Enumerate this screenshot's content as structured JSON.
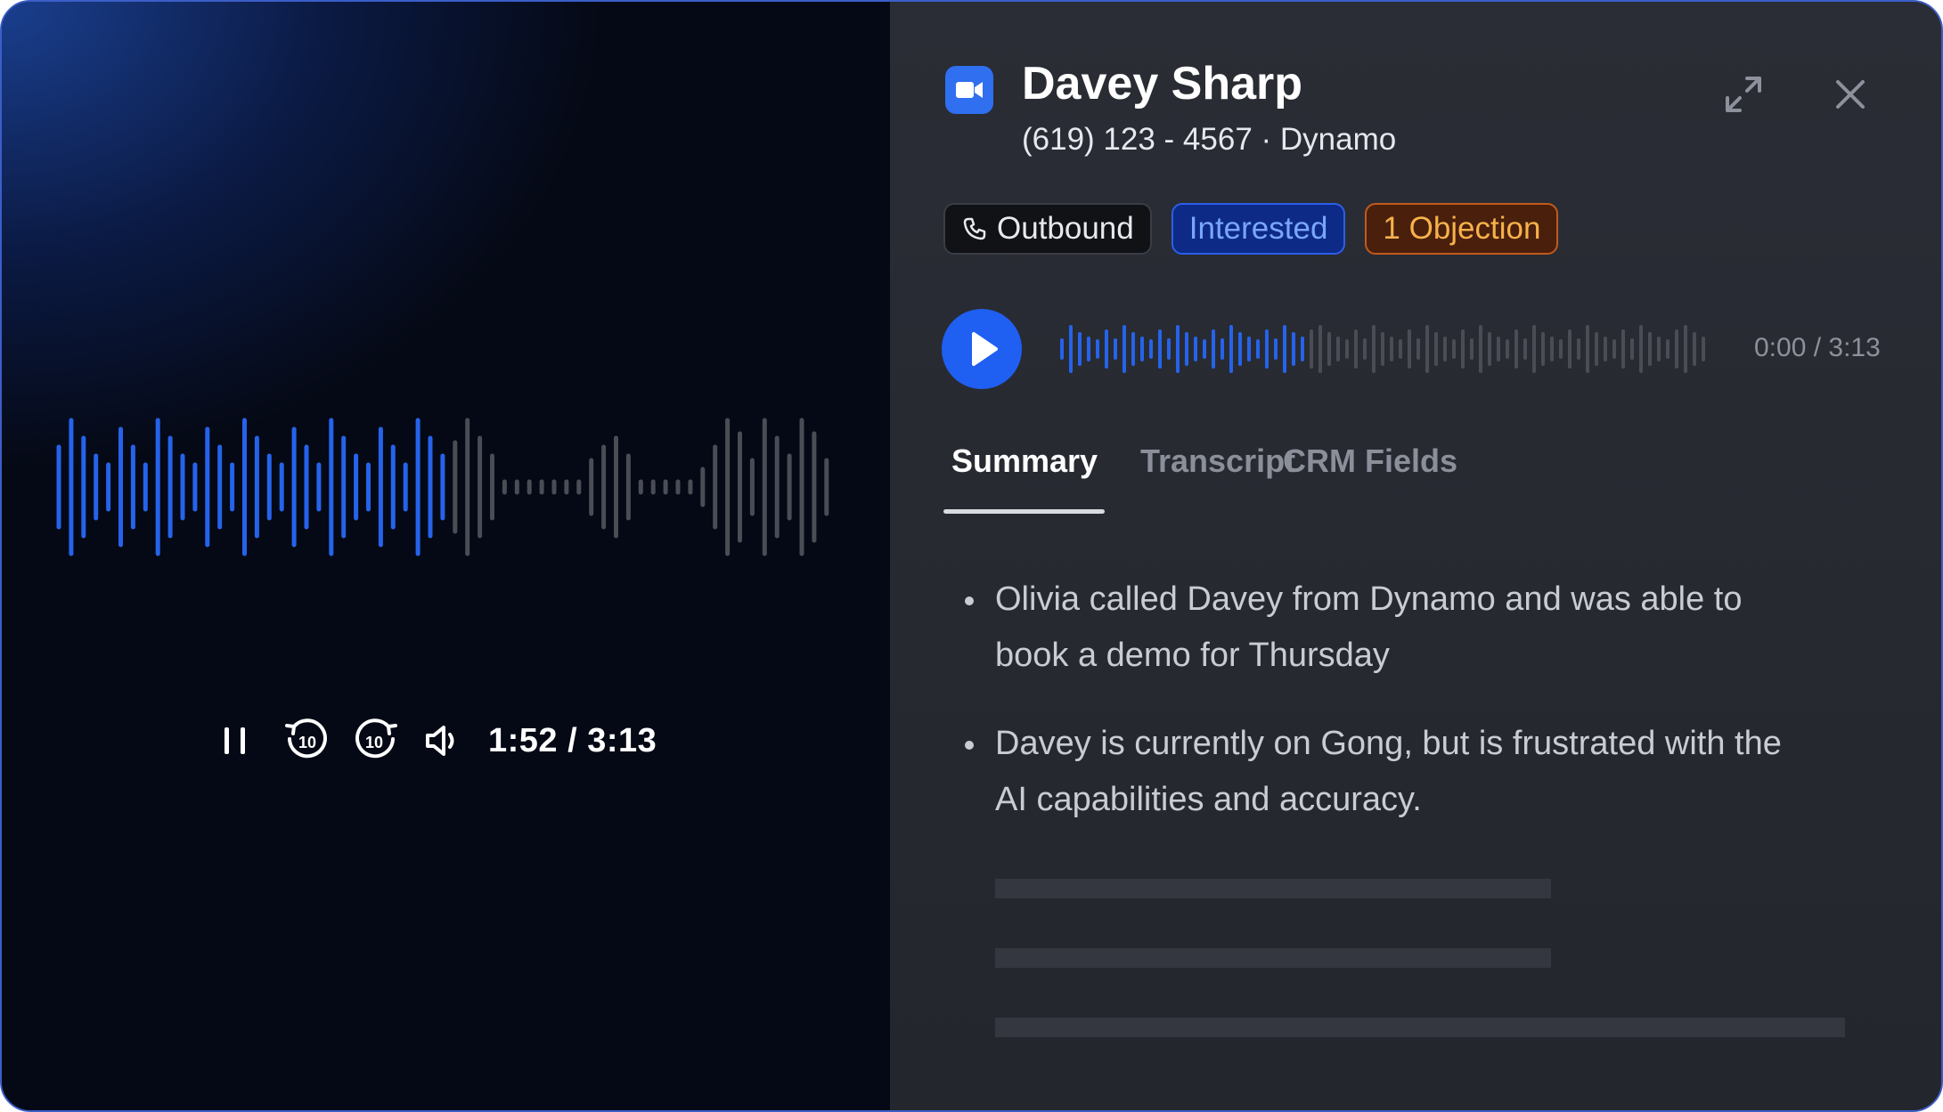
{
  "player": {
    "time": "1:52 / 3:13",
    "icons": [
      "pause-icon",
      "rewind-10-icon",
      "forward-10-icon",
      "volume-icon"
    ]
  },
  "contact": {
    "name": "Davey Sharp",
    "details": "(619) 123 - 4567 · Dynamo"
  },
  "tags": {
    "outbound": "Outbound",
    "interested": "Interested",
    "objection": "1 Objection"
  },
  "mini_player": {
    "time": "0:00 / 3:13"
  },
  "tabs": [
    {
      "label": "Summary",
      "active": true
    },
    {
      "label": "Transcript",
      "active": false
    },
    {
      "label": "CRM Fields",
      "active": false
    }
  ],
  "summary": [
    "Olivia called Davey from Dynamo and was able to book a demo for Thursday",
    "Davey is currently on Gong, but is frustrated with the AI capabilities and accuracy."
  ],
  "colors": {
    "accent": "#1f5ff2",
    "waveform_played": "#2563eb",
    "waveform_unplayed": "#4a4d55",
    "interested": "#7aa6ff",
    "objection": "#f6b24a"
  }
}
